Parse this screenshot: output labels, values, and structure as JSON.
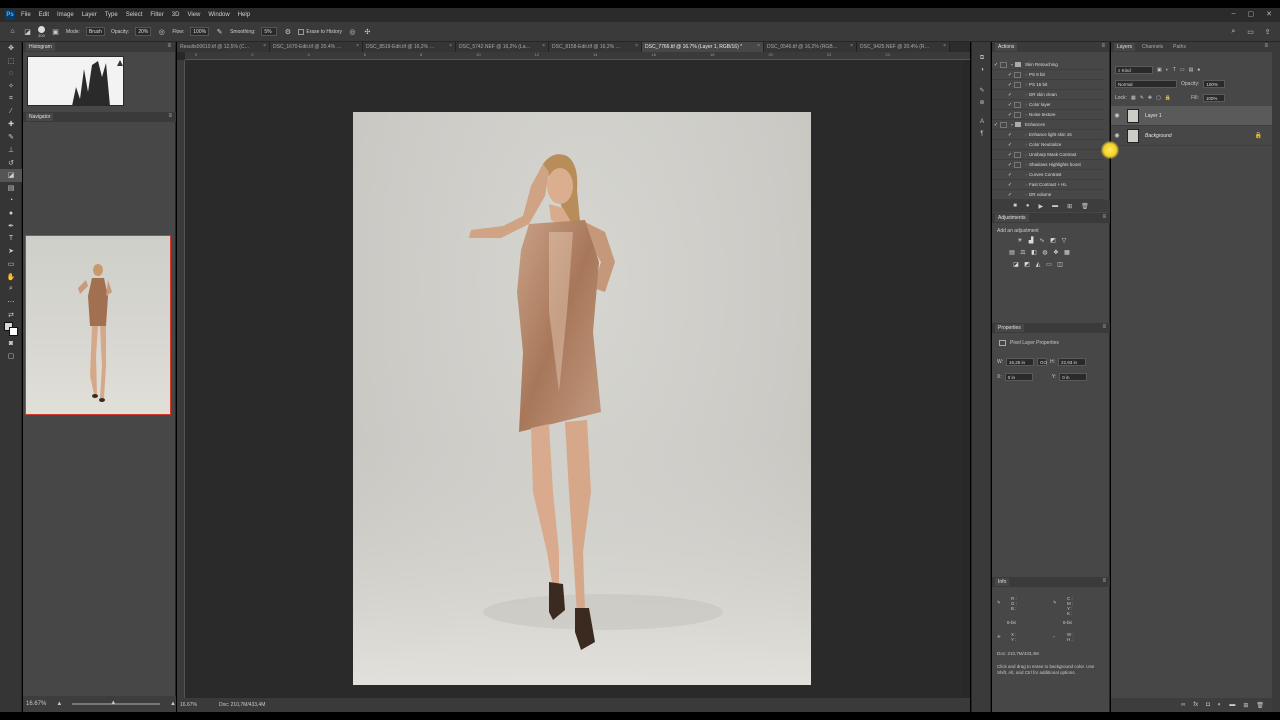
{
  "menubar": {
    "logo": "Ps",
    "items": [
      "File",
      "Edit",
      "Image",
      "Layer",
      "Type",
      "Select",
      "Filter",
      "3D",
      "View",
      "Window",
      "Help"
    ],
    "window_controls": [
      "–",
      "▢",
      "✕"
    ]
  },
  "options": {
    "brush_size": "300",
    "mode_label": "Mode:",
    "mode_value": "Brush",
    "opacity_label": "Opacity:",
    "opacity_value": "20%",
    "flow_label": "Flow:",
    "flow_value": "100%",
    "smoothing_label": "Smoothing:",
    "smoothing_value": "5%",
    "erase_history": "Erase to History"
  },
  "histogram": {
    "tab": "Histogram"
  },
  "navigator": {
    "tab": "Navigator",
    "zoom": "16.67%"
  },
  "document": {
    "tabs": [
      {
        "label": "Results00610.tif @ 12,5% (C…",
        "active": false
      },
      {
        "label": "DSC_1670-Edit.tif @ 20.4% …",
        "active": false
      },
      {
        "label": "DSC_8519-Edit.tif @ 16,2% …",
        "active": false
      },
      {
        "label": "DSC_5742.NEF @ 16,2% (La…",
        "active": false
      },
      {
        "label": "DSC_8158-Edit.tif @ 16,2% …",
        "active": false
      },
      {
        "label": "DSC_7766.tif @ 16.7% (Layer 1, RGB/16) *",
        "active": true
      },
      {
        "label": "DSC_0546.tif @ 16,2% (RGB…",
        "active": false
      },
      {
        "label": "DSC_9425.NEF @ 20.4% (R…",
        "active": false
      }
    ],
    "ruler_marks": [
      "0",
      "2",
      "4",
      "6",
      "8",
      "10",
      "12",
      "14",
      "16",
      "18",
      "20",
      "22",
      "24",
      "26"
    ],
    "status_zoom": "16.67%",
    "status_doc": "Doc: 210,7M/433,4M"
  },
  "actions": {
    "tab": "Actions",
    "rows": [
      {
        "label": "Skin Retouching",
        "folder": true
      },
      {
        "label": "PS 8 bit",
        "folder": false
      },
      {
        "label": "PS 16 bit",
        "folder": false
      },
      {
        "label": "DR skin clean",
        "folder": false
      },
      {
        "label": "Color layer",
        "folder": false
      },
      {
        "label": "Noise texture",
        "folder": false
      },
      {
        "label": "Enhances",
        "folder": true
      },
      {
        "label": "Enhance light skin 16",
        "folder": false
      },
      {
        "label": "Color Neutralize",
        "folder": false
      },
      {
        "label": "Unsharp Mask Contrast",
        "folder": false
      },
      {
        "label": "Shadows Highlights boost",
        "folder": false
      },
      {
        "label": "Curves Contrast",
        "folder": false
      },
      {
        "label": "Fast Contrast + HL",
        "folder": false
      },
      {
        "label": "DR volume",
        "folder": false
      }
    ]
  },
  "adjustments": {
    "tab": "Adjustments",
    "hint": "Add an adjustment"
  },
  "properties": {
    "tab": "Properties",
    "title": "Pixel Layer Properties",
    "w_label": "W:",
    "w_value": "16,25 in",
    "link": "GO",
    "h_label": "H:",
    "h_value": "22,93 in",
    "x_label": "X:",
    "x_value": "0 in",
    "y_label": "Y:",
    "y_value": "0 in"
  },
  "info": {
    "tab": "Info",
    "rgb": "R :\nG :\nB :",
    "cmyk": "C :\nM :\nY :\nK :",
    "bit1": "8-bit",
    "bit2": "8-bit",
    "xy": "X :\nY :",
    "wh": "W :\nH :",
    "doc": "Doc: 210,7M/433,4M",
    "hint": "Click and drag to erase to background color. Use Shift, Alt, and Ctrl for additional options."
  },
  "layers": {
    "tabs": [
      "Layers",
      "Channels",
      "Paths"
    ],
    "kind": "Kind",
    "blend": "Normal",
    "opacity_label": "Opacity:",
    "opacity_value": "100%",
    "lock_label": "Lock:",
    "fill_label": "Fill:",
    "fill_value": "100%",
    "items": [
      {
        "name": "Layer 1",
        "selected": true
      },
      {
        "name": "Background",
        "selected": false
      }
    ]
  }
}
